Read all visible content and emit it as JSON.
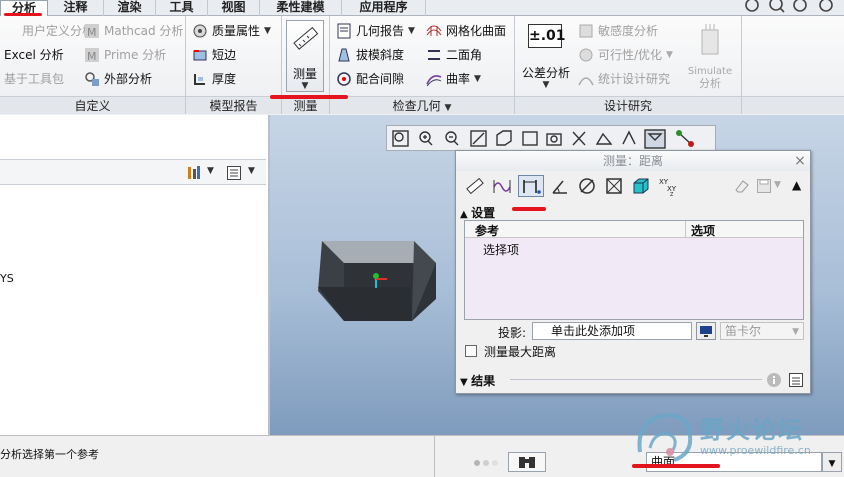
{
  "tabs": [
    "分析",
    "注释",
    "渲染",
    "工具",
    "视图",
    "柔性建模",
    "应用程序"
  ],
  "ribbon": {
    "custom": {
      "items": [
        "用户定义分析",
        "Excel 分析",
        "基于工具包"
      ],
      "items2": [
        "Mathcad 分析",
        "Prime 分析",
        "外部分析"
      ],
      "label": "自定义"
    },
    "model_report": {
      "items": [
        "质量属性",
        "短边",
        "厚度"
      ],
      "label": "模型报告"
    },
    "measure": {
      "button": "测量",
      "label": "测量"
    },
    "inspect": {
      "items": [
        "几何报告",
        "拔模斜度",
        "配合间隙"
      ],
      "items2": [
        "网格化曲面",
        "二面角",
        "曲率"
      ],
      "label": "检查几何"
    },
    "design_study": {
      "tolerance_icon": "±.01",
      "tolerance": "公差分析",
      "items": [
        "敏感度分析",
        "可行性/优化",
        "统计设计研究"
      ],
      "simulate1": "Simulate",
      "simulate2": "分析",
      "label": "设计研究"
    }
  },
  "left_panel": {
    "fragment": "YS"
  },
  "dialog": {
    "title": "测量：距离",
    "section": "设置",
    "col_ref": "参考",
    "col_opt": "选项",
    "row": "选择项",
    "projection_label": "投影:",
    "projection_value": "单击此处添加项",
    "coord_value": "笛卡尔",
    "max_distance": "测量最大距离",
    "results": "结果",
    "icons": [
      "ruler-icon",
      "curve-length-icon",
      "distance-icon",
      "angle-icon",
      "diameter-icon",
      "area-icon",
      "volume-icon",
      "transform-icon"
    ]
  },
  "status": {
    "message": "分析选择第一个参考",
    "filter": "曲面"
  },
  "watermark": {
    "name": "野火论坛",
    "url": "www.proewildfire.cn"
  },
  "colors": {
    "highlight": "#e3141e",
    "viewport_top": "#c7d5e6",
    "viewport_bottom": "#7f9bbd"
  }
}
